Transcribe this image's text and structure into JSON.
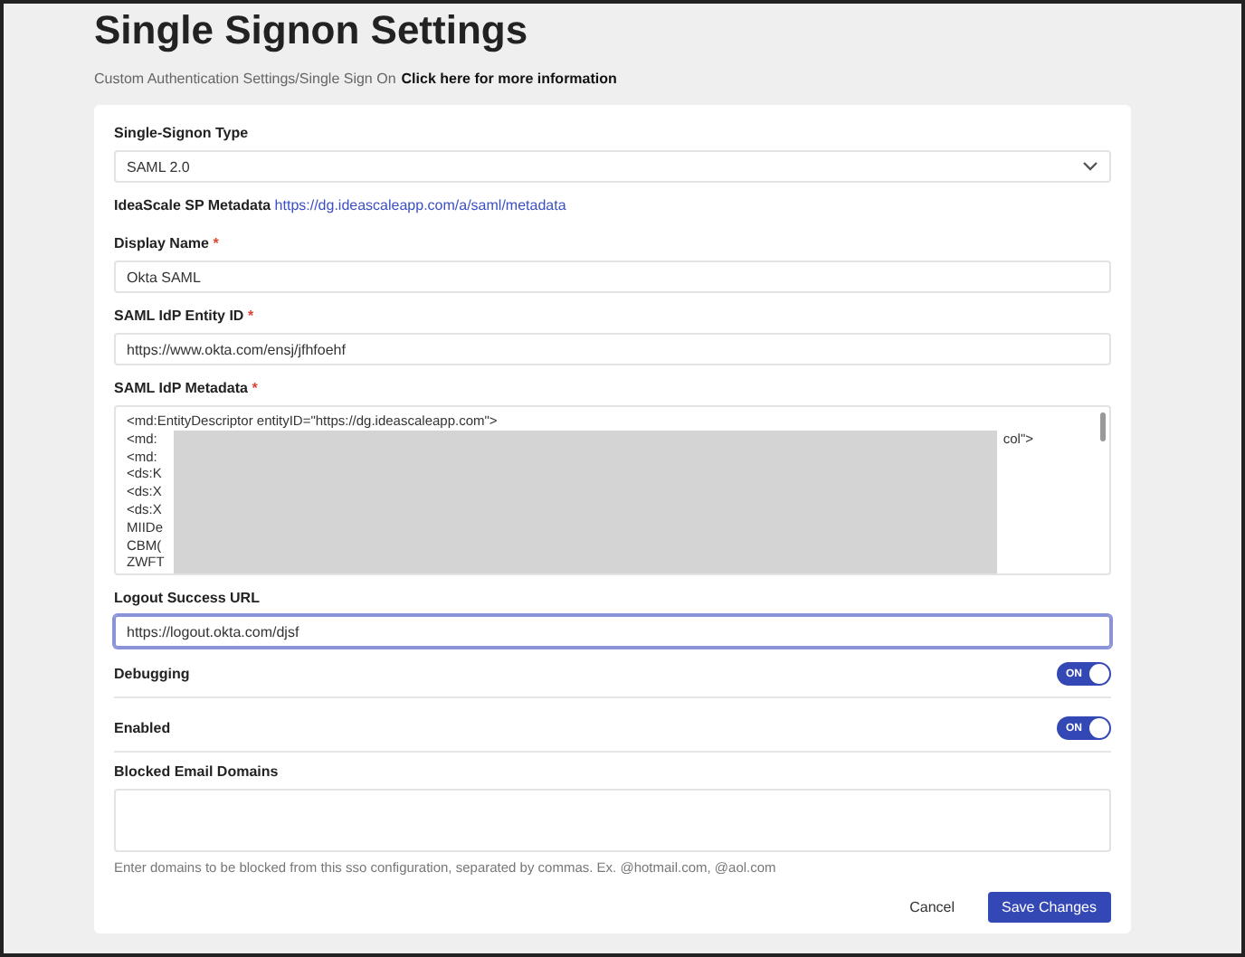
{
  "page": {
    "title": "Single Signon Settings",
    "breadcrumb": "Custom Authentication Settings/Single Sign On",
    "info_link": "Click here for more information"
  },
  "form": {
    "type": {
      "label": "Single-Signon Type",
      "value": "SAML 2.0"
    },
    "sp_metadata": {
      "label": "IdeaScale SP Metadata",
      "link": "https://dg.ideascaleapp.com/a/saml/metadata"
    },
    "fields": [
      {
        "label": "Display Name",
        "required_mark": "*",
        "value": "Okta SAML",
        "focused": false
      },
      {
        "label": "SAML IdP Entity ID",
        "required_mark": "*",
        "value": "https://www.okta.com/ensj/jfhfoehf",
        "focused": false
      }
    ],
    "metadata": {
      "label": "SAML IdP Metadata",
      "required_mark": "*",
      "lines": [
        {
          "text": "<md:EntityDescriptor entityID=\"https://dg.ideascaleapp.com\">"
        },
        {
          "text": "<md:",
          "tail": "col\">"
        },
        {
          "text": "<md:"
        },
        {
          "text": "<ds:K"
        },
        {
          "text": "<ds:X"
        },
        {
          "text": "<ds:X"
        },
        {
          "text": "MIIDe"
        },
        {
          "text": "CBM("
        },
        {
          "text": "ZWFT"
        }
      ]
    },
    "logout": {
      "label": "Logout Success URL",
      "value": "https://logout.okta.com/djsf",
      "focused": true
    },
    "toggles": [
      {
        "label": "Debugging",
        "on": true,
        "text": "ON"
      },
      {
        "label": "Enabled",
        "on": true,
        "text": "ON"
      }
    ],
    "blocked": {
      "label": "Blocked Email Domains",
      "help": "Enter domains to be blocked from this sso configuration, separated by commas. Ex. @hotmail.com, @aol.com"
    },
    "buttons": [
      {
        "label": "Cancel",
        "kind": "link"
      },
      {
        "label": "Save Changes",
        "kind": "primary"
      }
    ]
  }
}
